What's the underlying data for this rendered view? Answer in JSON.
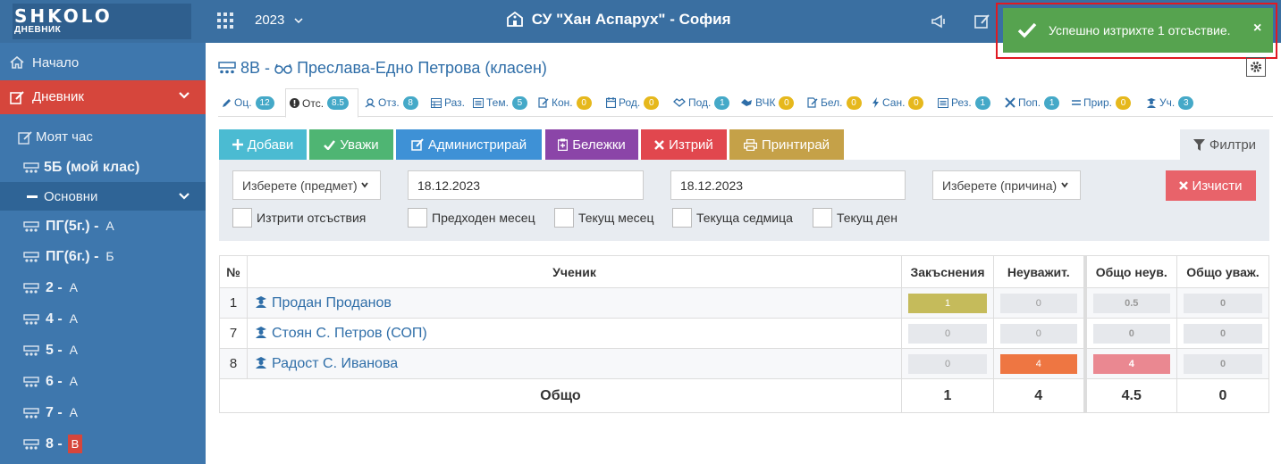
{
  "app": {
    "logo_text": "SHKOLO",
    "logo_sub": "ДНЕВНИК",
    "year": "2023",
    "school": "СУ \"Хан Аспарух\" - София"
  },
  "toast": {
    "message": "Успешно изтрихте 1 отсъствие.",
    "close": "×"
  },
  "sidebar": {
    "home": "Начало",
    "diary": "Дневник",
    "my_hour": "Моят час",
    "my_class": "5Б (мой клас)",
    "basic": "Основни",
    "classes": [
      {
        "name": "ПГ(5г.) -",
        "letter": "А"
      },
      {
        "name": "ПГ(6г.) -",
        "letter": "Б"
      },
      {
        "name": "2 -",
        "letter": "А"
      },
      {
        "name": "4 -",
        "letter": "А"
      },
      {
        "name": "5 -",
        "letter": "А"
      },
      {
        "name": "6 -",
        "letter": "А"
      },
      {
        "name": "7 -",
        "letter": "А"
      },
      {
        "name": "8 -",
        "letter": "В"
      }
    ]
  },
  "header": {
    "class_code": "8В -",
    "teacher": "Преслава-Едно Петрова (класен)"
  },
  "tabs": [
    {
      "label": "Оц.",
      "count": "12",
      "color": "blue"
    },
    {
      "label": "Отс.",
      "count": "8.5",
      "color": "blue"
    },
    {
      "label": "Отз.",
      "count": "8",
      "color": "blue"
    },
    {
      "label": "Раз.",
      "count": "",
      "color": ""
    },
    {
      "label": "Тем.",
      "count": "5",
      "color": "blue"
    },
    {
      "label": "Кон.",
      "count": "0",
      "color": "yellow"
    },
    {
      "label": "Род.",
      "count": "0",
      "color": "yellow"
    },
    {
      "label": "Под.",
      "count": "1",
      "color": "blue"
    },
    {
      "label": "ВЧК",
      "count": "0",
      "color": "yellow"
    },
    {
      "label": "Бел.",
      "count": "0",
      "color": "yellow"
    },
    {
      "label": "Сан.",
      "count": "0",
      "color": "yellow"
    },
    {
      "label": "Рез.",
      "count": "1",
      "color": "blue"
    },
    {
      "label": "Поп.",
      "count": "1",
      "color": "blue"
    },
    {
      "label": "Прир.",
      "count": "0",
      "color": "yellow"
    },
    {
      "label": "Уч.",
      "count": "3",
      "color": "blue"
    }
  ],
  "toolbar": {
    "add": "Добави",
    "excuse": "Уважи",
    "admin": "Администрирай",
    "notes": "Бележки",
    "delete": "Изтрий",
    "print": "Принтирай",
    "filters": "Филтри"
  },
  "filters": {
    "subject_placeholder": "Изберете (предмет)",
    "date_from": "18.12.2023",
    "date_to": "18.12.2023",
    "reason_placeholder": "Изберете (причина)",
    "clear": "Изчисти",
    "deleted": "Изтрити отсъствия",
    "prev_month": "Предходен месец",
    "cur_month": "Текущ месец",
    "cur_week": "Текуща седмица",
    "cur_day": "Текущ ден"
  },
  "table": {
    "headers": {
      "num": "№",
      "student": "Ученик",
      "late": "Закъснения",
      "unexcused": "Неуважит.",
      "total_unexcused": "Общо неув.",
      "total_excused": "Общо уваж."
    },
    "rows": [
      {
        "num": "1",
        "name": "Продан Проданов",
        "late": "1",
        "unexcused": "0",
        "total_unexcused": "0.5",
        "total_excused": "0"
      },
      {
        "num": "7",
        "name": "Стоян С. Петров (СОП)",
        "late": "0",
        "unexcused": "0",
        "total_unexcused": "0",
        "total_excused": "0"
      },
      {
        "num": "8",
        "name": "Радост С. Иванова",
        "late": "0",
        "unexcused": "4",
        "total_unexcused": "4",
        "total_excused": "0"
      }
    ],
    "total": {
      "label": "Общо",
      "late": "1",
      "unexcused": "4",
      "total_unexcused": "4.5",
      "total_excused": "0"
    }
  },
  "colors": {
    "topbar": "#3a6fa1",
    "sidebar": "#3e77ad",
    "active": "#d6463c",
    "toast": "#56a34f"
  }
}
